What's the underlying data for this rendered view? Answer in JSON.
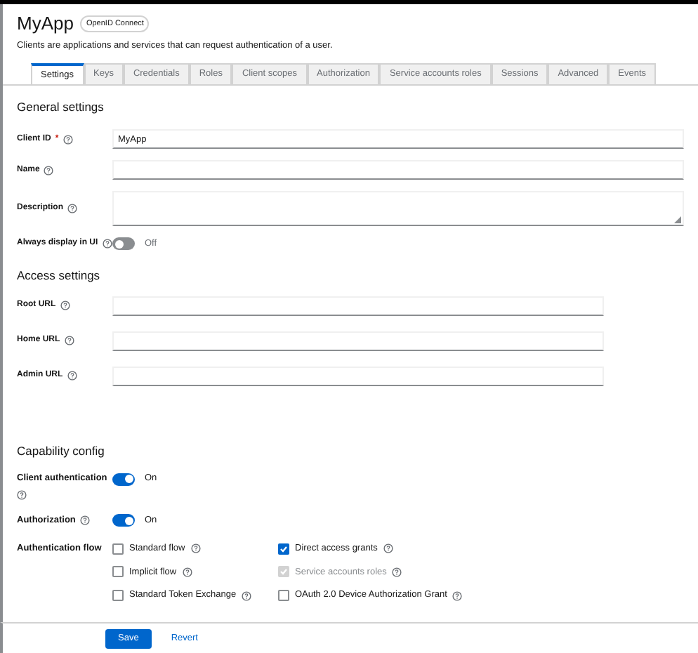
{
  "header": {
    "title": "MyApp",
    "badge": "OpenID Connect",
    "description": "Clients are applications and services that can request authentication of a user."
  },
  "tabs": [
    {
      "label": "Settings",
      "selected": true
    },
    {
      "label": "Keys",
      "selected": false
    },
    {
      "label": "Credentials",
      "selected": false
    },
    {
      "label": "Roles",
      "selected": false
    },
    {
      "label": "Client scopes",
      "selected": false
    },
    {
      "label": "Authorization",
      "selected": false
    },
    {
      "label": "Service accounts roles",
      "selected": false
    },
    {
      "label": "Sessions",
      "selected": false
    },
    {
      "label": "Advanced",
      "selected": false
    },
    {
      "label": "Events",
      "selected": false
    }
  ],
  "general_settings": {
    "heading": "General settings",
    "fields": [
      {
        "kind": "input",
        "label": "Client ID",
        "required_mark": "*",
        "value": "MyApp"
      },
      {
        "kind": "input",
        "label": "Name"
      },
      {
        "kind": "textarea",
        "label": "Description"
      },
      {
        "kind": "switch",
        "label": "Always display in UI",
        "on": false,
        "state_label": "Off"
      }
    ]
  },
  "access_settings": {
    "heading": "Access settings",
    "fields": [
      {
        "kind": "input",
        "label": "Root URL"
      },
      {
        "kind": "input",
        "label": "Home URL"
      },
      {
        "kind": "input",
        "label": "Admin URL"
      }
    ]
  },
  "capability_config": {
    "heading": "Capability config",
    "switches": [
      {
        "label": "Client authentication",
        "on": true,
        "state_label": "On"
      },
      {
        "label": "Authorization",
        "on": true,
        "state_label": "On"
      }
    ],
    "flow_label": "Authentication flow",
    "flows": [
      {
        "label": "Standard flow",
        "checked": false,
        "disabled": false
      },
      {
        "label": "Direct access grants",
        "checked": true,
        "disabled": false
      },
      {
        "label": "Implicit flow",
        "checked": false,
        "disabled": false
      },
      {
        "label": "Service accounts roles",
        "checked": true,
        "disabled": true
      },
      {
        "label": "Standard Token Exchange",
        "checked": false,
        "disabled": false
      },
      {
        "label": "OAuth 2.0 Device Authorization Grant",
        "checked": false,
        "disabled": false
      }
    ]
  },
  "footer": {
    "buttons": [
      {
        "kind": "primary",
        "label": "Save"
      },
      {
        "kind": "link",
        "label": "Revert"
      }
    ]
  }
}
